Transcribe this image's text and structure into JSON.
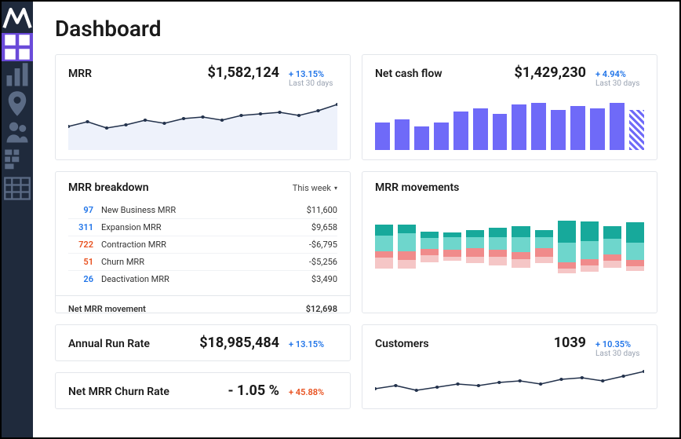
{
  "page_title": "Dashboard",
  "sidebar": {
    "items": [
      {
        "name": "dashboard",
        "active": true
      },
      {
        "name": "reports",
        "active": false
      },
      {
        "name": "location",
        "active": false
      },
      {
        "name": "customers",
        "active": false
      },
      {
        "name": "segments",
        "active": false
      },
      {
        "name": "tables",
        "active": false
      }
    ]
  },
  "cards": {
    "mrr": {
      "title": "MRR",
      "value": "$1,582,124",
      "delta_pct": "+ 13.15%",
      "delta_sub": "Last 30 days"
    },
    "netcash": {
      "title": "Net cash flow",
      "value": "$1,429,230",
      "delta_pct": "+ 4.94%",
      "delta_sub": "Last 30 days"
    },
    "breakdown": {
      "title": "MRR breakdown",
      "dropdown_label": "This week",
      "rows": [
        {
          "count": "97",
          "count_class": "blue",
          "label": "New Business MRR",
          "value": "$11,600"
        },
        {
          "count": "311",
          "count_class": "blue",
          "label": "Expansion MRR",
          "value": "$9,658"
        },
        {
          "count": "722",
          "count_class": "red",
          "label": "Contraction MRR",
          "value": "-$6,795"
        },
        {
          "count": "51",
          "count_class": "red",
          "label": "Churn MRR",
          "value": "-$5,256"
        },
        {
          "count": "26",
          "count_class": "blue",
          "label": "Deactivation MRR",
          "value": "$3,490"
        }
      ],
      "net_label": "Net MRR movement",
      "net_value": "$12,698"
    },
    "movements": {
      "title": "MRR movements"
    },
    "arr": {
      "title": "Annual Run Rate",
      "value": "$18,985,484",
      "delta_pct": "+ 13.15%"
    },
    "customers": {
      "title": "Customers",
      "value": "1039",
      "delta_pct": "+ 10.35%",
      "delta_sub": "Last 30 days"
    },
    "churnrate": {
      "title": "Net MRR Churn Rate",
      "value": "- 1.05 %",
      "delta_pct": "+ 45.88%"
    }
  },
  "chart_data": [
    {
      "type": "line",
      "name": "mrr_trend",
      "values": [
        30,
        36,
        28,
        32,
        38,
        34,
        40,
        42,
        38,
        44,
        46,
        48,
        44,
        50,
        58
      ],
      "ylim": [
        0,
        70
      ]
    },
    {
      "type": "bar",
      "name": "netcash_bars",
      "values": [
        30,
        34,
        26,
        30,
        42,
        46,
        40,
        50,
        52,
        44,
        48,
        46,
        52,
        44
      ],
      "ylim": [
        0,
        60
      ],
      "note": "last bar is projected/hatched"
    },
    {
      "type": "bar",
      "name": "mrr_movements_stacked",
      "series": [
        {
          "name": "dark_teal",
          "values": [
            10,
            8,
            6,
            4,
            6,
            8,
            10,
            6,
            20,
            18,
            12,
            18
          ]
        },
        {
          "name": "light_teal",
          "values": [
            14,
            16,
            10,
            12,
            10,
            12,
            14,
            10,
            18,
            16,
            14,
            16
          ]
        },
        {
          "name": "red",
          "values": [
            6,
            8,
            6,
            6,
            8,
            6,
            6,
            8,
            6,
            6,
            6,
            6
          ]
        },
        {
          "name": "pink",
          "values": [
            10,
            8,
            6,
            4,
            6,
            8,
            8,
            6,
            4,
            6,
            6,
            4
          ]
        }
      ]
    },
    {
      "type": "line",
      "name": "customers_trend",
      "values": [
        18,
        22,
        16,
        20,
        24,
        22,
        26,
        28,
        24,
        30,
        32,
        28,
        34,
        40
      ],
      "ylim": [
        0,
        50
      ]
    }
  ]
}
